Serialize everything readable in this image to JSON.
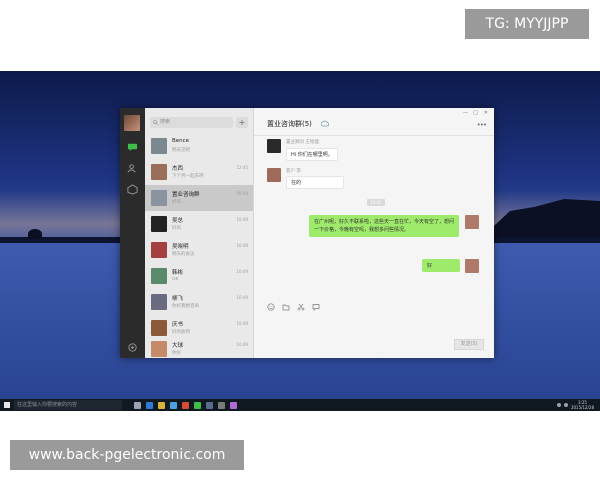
{
  "overlays": {
    "tg_label": "TG: MYYJJPP",
    "url_label": "www.back-pgelectronic.com"
  },
  "taskbar": {
    "search_placeholder": "在这里输入你要搜索的内容",
    "clock_time": "3:25",
    "clock_date": "2015/12/28"
  },
  "wechat": {
    "search_placeholder": "搜索",
    "add_label": "+",
    "chats": [
      {
        "name": "Bence",
        "snippet": "明天见吧",
        "time": "",
        "thumb": "#7c8890"
      },
      {
        "name": "杰西",
        "snippet": "下个月一起去吧",
        "time": "12:45",
        "thumb": "#9a6f5a"
      },
      {
        "name": "置业咨询群",
        "snippet": "好的",
        "time": "09:49",
        "thumb": "#8a94a0"
      },
      {
        "name": "吴总",
        "snippet": "好的",
        "time": "10:49",
        "thumb": "#222222"
      },
      {
        "name": "吴晓明",
        "snippet": "明天的会议",
        "time": "10:49",
        "thumb": "#a44040"
      },
      {
        "name": "韩彬",
        "snippet": "OK",
        "time": "10:49",
        "thumb": "#5a8a6a"
      },
      {
        "name": "柳飞",
        "snippet": "你好我想咨询",
        "time": "10:49",
        "thumb": "#6a6a80"
      },
      {
        "name": "庆书",
        "snippet": "好的收到",
        "time": "10:49",
        "thumb": "#8a5a3a"
      },
      {
        "name": "大球",
        "snippet": "你好",
        "time": "10:49",
        "thumb": "#c48a6a"
      }
    ],
    "conversation": {
      "title": "置业咨询群(5)",
      "messages": [
        {
          "sender": "置业顾问 王经理",
          "text": "Hi 你们在哪里啊。"
        },
        {
          "sender": "客户 李",
          "text": "在的"
        }
      ],
      "timestamp": "10:41",
      "own_long_message": "在广州呢，好久不联系啦，这些天一直在忙，今天有空了，想问一下价格，今晚有空吗，我想多问些情况。",
      "own_short_message": "好",
      "send_label": "发送(S)"
    }
  }
}
